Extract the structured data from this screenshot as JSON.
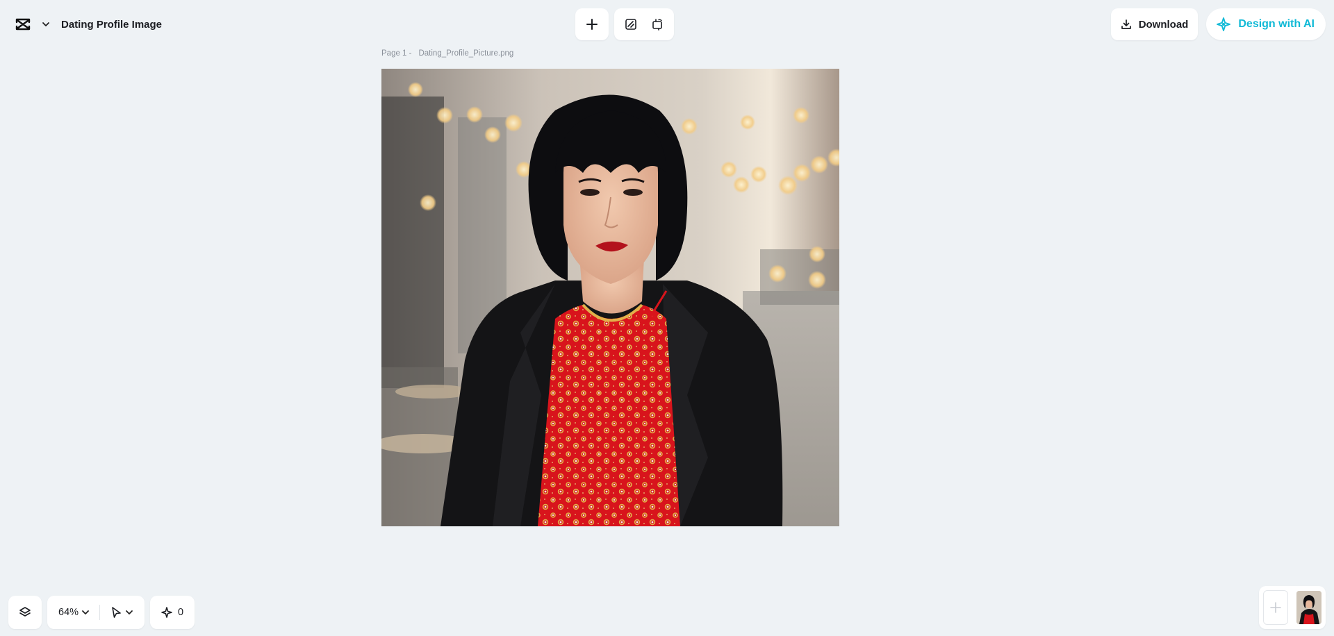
{
  "header": {
    "logo_icon": "capcut-logo-icon",
    "document_title": "Dating Profile Image"
  },
  "toolbar": {
    "add_icon": "plus-icon",
    "resize_icon": "edit-image-icon",
    "crop_icon": "crop-rotate-icon"
  },
  "actions": {
    "download_label": "Download",
    "design_ai_label": "Design with AI",
    "accent_color": "#10b9d6"
  },
  "canvas": {
    "page_label": "Page 1 -",
    "file_name": "Dating_Profile_Picture.png",
    "image_subject": "portrait-photo"
  },
  "bottom_bar": {
    "zoom_label": "64%",
    "credits_count": "0"
  }
}
